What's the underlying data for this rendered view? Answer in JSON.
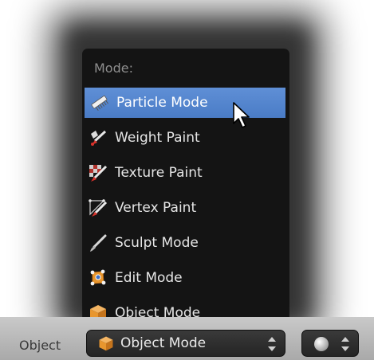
{
  "menu": {
    "title": "Mode:",
    "items": [
      {
        "label": "Particle Mode",
        "icon": "particle-comb-icon",
        "active": true
      },
      {
        "label": "Weight Paint",
        "icon": "weight-paint-icon",
        "active": false
      },
      {
        "label": "Texture Paint",
        "icon": "texture-paint-icon",
        "active": false
      },
      {
        "label": "Vertex Paint",
        "icon": "vertex-paint-icon",
        "active": false
      },
      {
        "label": "Sculpt Mode",
        "icon": "sculpt-brush-icon",
        "active": false
      },
      {
        "label": "Edit Mode",
        "icon": "edit-mode-icon",
        "active": false
      },
      {
        "label": "Object Mode",
        "icon": "object-cube-icon",
        "active": false
      }
    ]
  },
  "header": {
    "menu_label": "Object",
    "mode_select": {
      "value": "Object Mode",
      "icon": "object-cube-icon"
    },
    "shading_select": {
      "icon": "shading-sphere-icon"
    }
  },
  "colors": {
    "highlight": "#5f8fd6",
    "menu_bg": "#141414",
    "cube_orange": "#e8962e"
  }
}
